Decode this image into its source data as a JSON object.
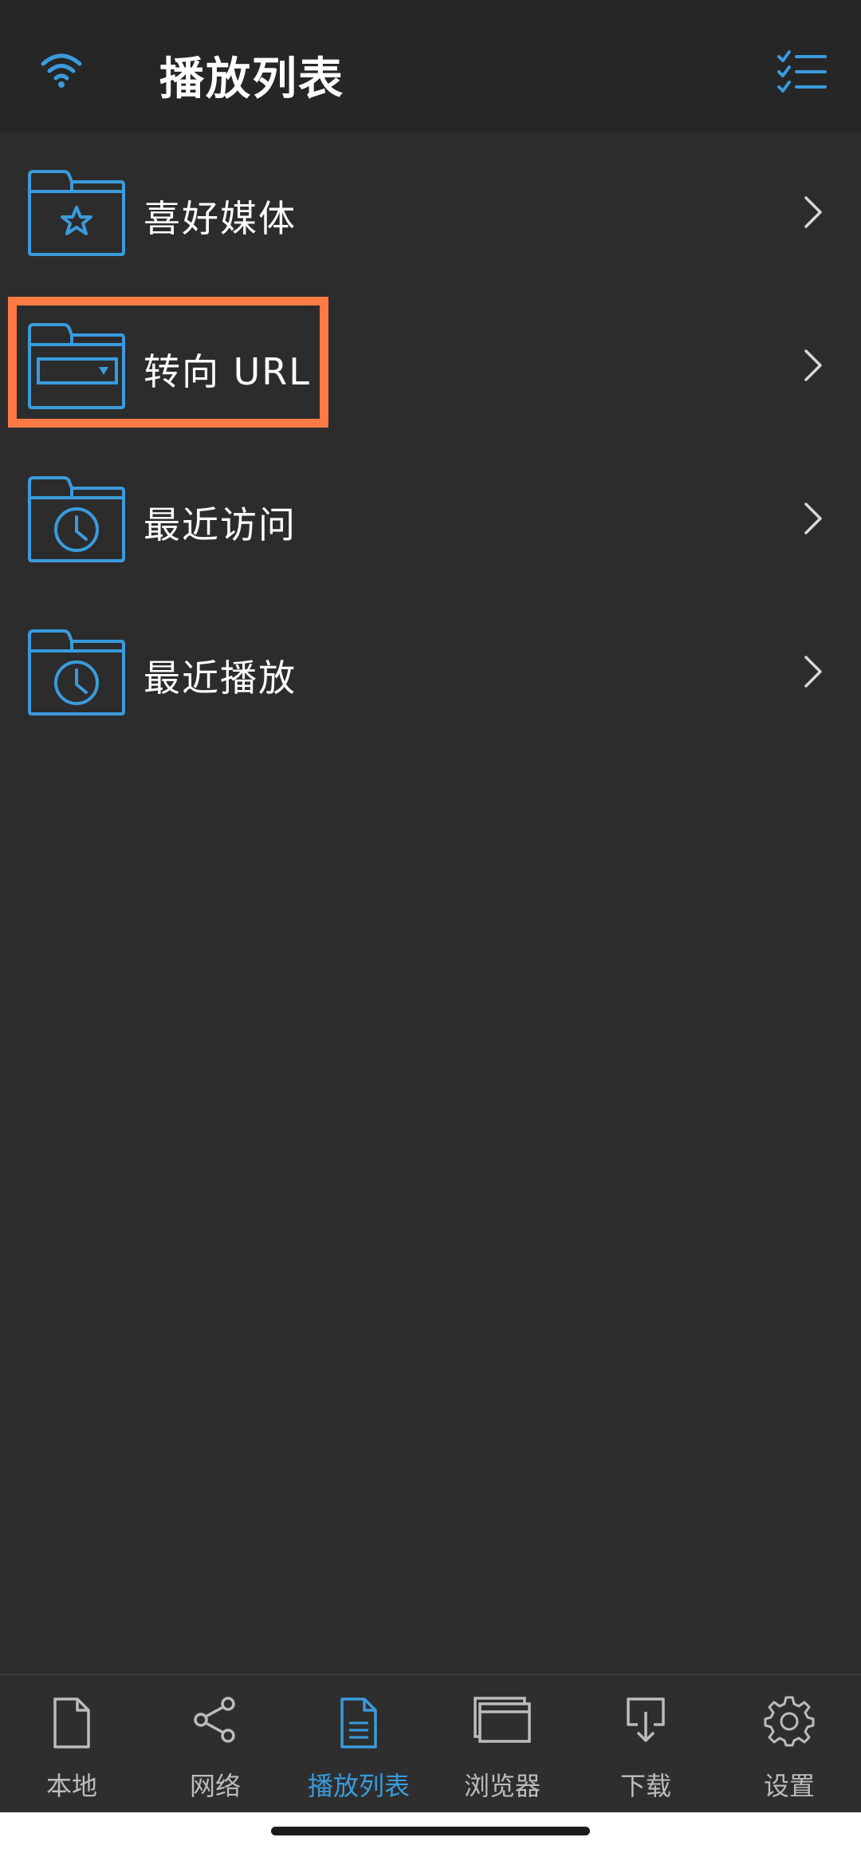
{
  "header": {
    "title": "播放列表",
    "wifi_icon": "wifi-icon",
    "edit_icon": "checklist-icon"
  },
  "playlists": [
    {
      "label": "喜好媒体",
      "icon": "folder-star-icon"
    },
    {
      "label": "转向 URL",
      "icon": "folder-url-icon"
    },
    {
      "label": "最近访问",
      "icon": "folder-clock-icon"
    },
    {
      "label": "最近播放",
      "icon": "folder-clock-icon"
    }
  ],
  "tabs": [
    {
      "label": "本地",
      "icon": "file-icon"
    },
    {
      "label": "网络",
      "icon": "share-icon"
    },
    {
      "label": "播放列表",
      "icon": "document-list-icon",
      "active": true
    },
    {
      "label": "浏览器",
      "icon": "browser-window-icon"
    },
    {
      "label": "下载",
      "icon": "download-icon"
    },
    {
      "label": "设置",
      "icon": "gear-icon"
    }
  ],
  "colors": {
    "accent": "#3a9bdc",
    "background": "#2c2c2d",
    "header": "#262627",
    "highlight": "#ff7a45",
    "tab_inactive": "#bcbcbe"
  }
}
